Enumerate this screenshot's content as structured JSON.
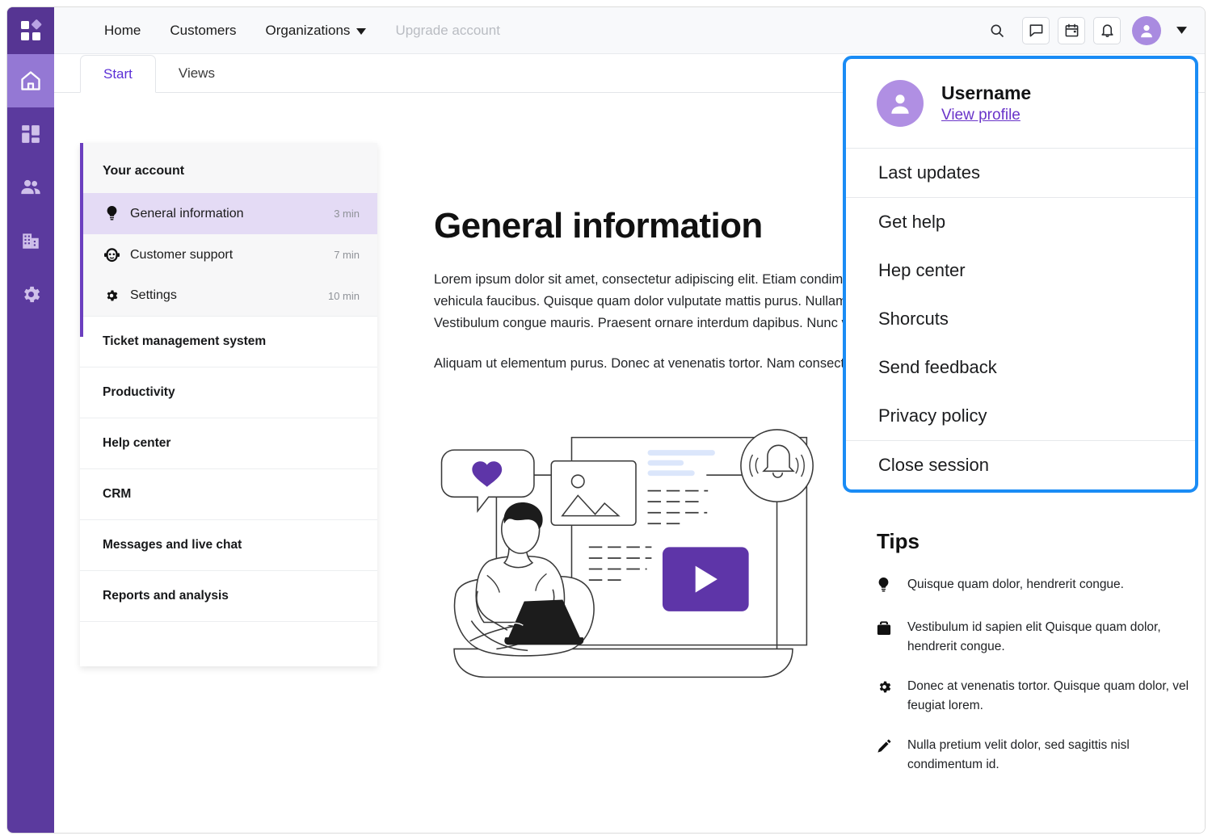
{
  "colors": {
    "rail": "#5b3a9e",
    "rail_logo": "#563593",
    "rail_active": "#9478d4",
    "accent_purple": "#6b3fbf",
    "tab_active_text": "#5b2fd6",
    "nav_active_bg": "#e4dbf5",
    "overlay_border": "#1a8cf5",
    "avatar": "#a98be0",
    "menu_avatar": "#b08fe3",
    "link": "#6a35c9",
    "illustration_purple": "#5e35a8"
  },
  "rail": {
    "logo_icon": "app-grid-logo-icon",
    "items": [
      {
        "icon": "home-icon",
        "name": "rail-item-home",
        "active": true
      },
      {
        "icon": "dashboard-grid-icon",
        "name": "rail-item-dashboard",
        "active": false
      },
      {
        "icon": "people-icon",
        "name": "rail-item-customers",
        "active": false
      },
      {
        "icon": "building-icon",
        "name": "rail-item-organizations",
        "active": false
      },
      {
        "icon": "gear-icon",
        "name": "rail-item-settings",
        "active": false
      }
    ]
  },
  "topbar": {
    "nav": [
      {
        "label": "Home",
        "muted": false,
        "caret": false
      },
      {
        "label": "Customers",
        "muted": false,
        "caret": false
      },
      {
        "label": "Organizations",
        "muted": false,
        "caret": true
      },
      {
        "label": "Upgrade account",
        "muted": true,
        "caret": false
      }
    ],
    "icons": [
      {
        "name": "search-icon",
        "boxed": false
      },
      {
        "name": "chat-icon",
        "boxed": true
      },
      {
        "name": "calendar-icon",
        "boxed": true
      },
      {
        "name": "bell-icon",
        "boxed": true
      }
    ],
    "avatar_icon": "user-avatar-icon",
    "caret_icon": "chevron-down-icon"
  },
  "tabs": [
    {
      "label": "Start",
      "active": true
    },
    {
      "label": "Views",
      "active": false
    }
  ],
  "nav_card": {
    "section_title": "Your account",
    "sub_items": [
      {
        "icon": "lightbulb-icon",
        "label": "General information",
        "time": "3 min",
        "active": true
      },
      {
        "icon": "support-face-icon",
        "label": "Customer support",
        "time": "7 min",
        "active": false
      },
      {
        "icon": "gear-icon",
        "label": "Settings",
        "time": "10 min",
        "active": false
      }
    ],
    "rows": [
      "Ticket management system",
      "Productivity",
      "Help center",
      "CRM",
      "Messages and live chat",
      "Reports and analysis"
    ]
  },
  "main": {
    "title": "General information",
    "paragraphs": [
      "Lorem ipsum dolor sit amet, consectetur adipiscing elit. Etiam condimentum. Vestibulum id velit est. Cras ultricies vehicula faucibus. Quisque quam dolor vulputate mattis purus. Nullam sit amet leo vel eros ultricies euismod. Vestibulum congue mauris. Praesent ornare interdum dapibus. Nunc vitae luctus ante.",
      "Aliquam ut elementum purus. Donec at venenatis tortor. Nam consectetur, sed sagittis nisl condimentum id."
    ],
    "illustration_name": "person-with-laptop-illustration"
  },
  "tips": {
    "title": "Tips",
    "items": [
      {
        "icon": "lightbulb-icon",
        "text": "Quisque quam dolor, hendrerit congue."
      },
      {
        "icon": "briefcase-icon",
        "text": "Vestibulum id sapien elit Quisque quam dolor, hendrerit congue."
      },
      {
        "icon": "gear-icon",
        "text": "Donec at venenatis tortor. Quisque quam dolor, vel feugiat lorem."
      },
      {
        "icon": "pencil-icon",
        "text": "Nulla pretium velit dolor, sed sagittis nisl condimentum id."
      }
    ]
  },
  "account_menu": {
    "username": "Username",
    "view_profile": "View profile",
    "avatar_icon": "user-avatar-icon",
    "items": [
      {
        "label": "Last updates",
        "divider_after": true
      },
      {
        "label": "Get help",
        "divider_after": false
      },
      {
        "label": "Hep center",
        "divider_after": false
      },
      {
        "label": "Shorcuts",
        "divider_after": false
      },
      {
        "label": "Send feedback",
        "divider_after": false
      },
      {
        "label": "Privacy policy",
        "divider_after": true
      },
      {
        "label": "Close session",
        "divider_after": false
      }
    ]
  }
}
